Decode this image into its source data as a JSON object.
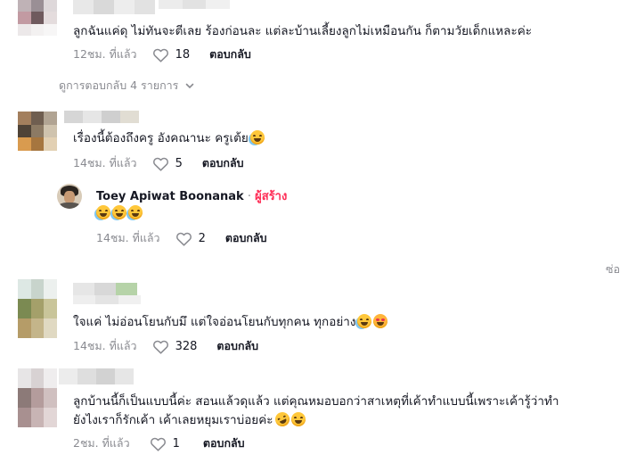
{
  "comments": [
    {
      "text": "ลูกฉันแค่ดุ ไม่ทันจะตีเลย ร้องก่อนละ แต่ละบ้านเลี้ยงลูกไม่เหมือนกัน ก็ตามวัยเด็กแหละค่ะ",
      "time": "12ชม. ที่แล้ว",
      "likes": "18",
      "reply_label": "ตอบกลับ",
      "emojis": []
    },
    {
      "text": "เรื่องนี้ต้องถึงครู อังคณานะ ครูเต้ย",
      "time": "14ชม. ที่แล้ว",
      "likes": "5",
      "reply_label": "ตอบกลับ",
      "emojis": [
        "face-with-tears-of-joy-emoji"
      ]
    },
    {
      "text": "ใจแค่ ไม่อ่อนโยนกับมึ แต่ใจอ่อนโยนกับทุกคน ทุกอย่าง",
      "time": "14ชม. ที่แล้ว",
      "likes": "328",
      "reply_label": "ตอบกลับ",
      "emojis": [
        "face-with-tears-of-joy-emoji",
        "smiling-face-with-hearts-emoji"
      ]
    },
    {
      "text_line1": "ลูกบ้านนี้ก็เป็นแบบนี้ค่ะ สอนแล้วดุแล้ว แต่คุณหมอบอกว่าสาเหตุที่เค้าทำแบบนี้เพราะเค้ารู้ว่าทำ",
      "text_line2": "ยังไงเราก็รักเค้า เค้าเลยหยุมเราบ่อยค่ะ",
      "time": "2ชม. ที่แล้ว",
      "likes": "1",
      "reply_label": "ตอบกลับ",
      "emojis": [
        "rolling-on-floor-laughing-emoji",
        "grinning-face-emoji"
      ]
    }
  ],
  "view_replies": {
    "label": "ดูการตอบกลับ 4 รายการ"
  },
  "creator_reply": {
    "author": "Toey Apiwat Boonanak",
    "separator": "·",
    "creator_badge": "ผู้สร้าง",
    "time": "14ชม. ที่แล้ว",
    "likes": "2",
    "reply_label": "ตอบกลับ",
    "emojis": [
      "face-with-tears-of-joy-emoji",
      "face-with-tears-of-joy-emoji",
      "face-with-tears-of-joy-emoji"
    ]
  },
  "side_text": "ซ่อ",
  "colors": {
    "creator_badge": "#fe2c55",
    "meta_gray": "#8a8b91",
    "text": "#161823"
  },
  "icons": {
    "like": "heart-outline-icon",
    "expand": "chevron-down-icon"
  }
}
